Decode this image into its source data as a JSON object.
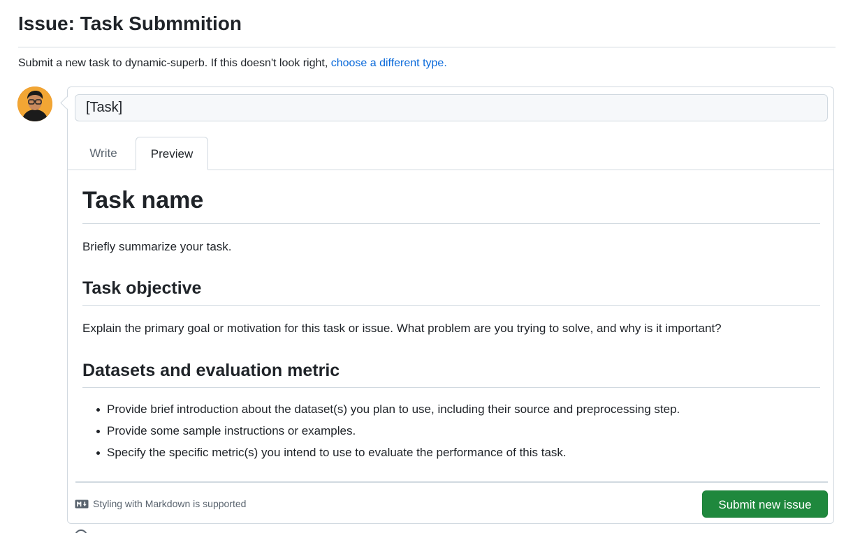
{
  "page": {
    "title": "Issue: Task Submmition",
    "subtitle_text": "Submit a new task to dynamic-superb. If this doesn't look right, ",
    "subtitle_link": "choose a different type."
  },
  "form": {
    "title_value": "[Task]",
    "tabs": [
      {
        "label": "Write",
        "active": false
      },
      {
        "label": "Preview",
        "active": true
      }
    ]
  },
  "preview": {
    "heading": "Task name",
    "summary": "Briefly summarize your task.",
    "objective_heading": "Task objective",
    "objective_text": "Explain the primary goal or motivation for this task or issue. What problem are you trying to solve, and why is it important?",
    "datasets_heading": "Datasets and evaluation metric",
    "bullets": [
      "Provide brief introduction about the dataset(s) you plan to use, including their source and preprocessing step.",
      "Provide some sample instructions or examples.",
      "Specify the specific metric(s) you intend to use to evaluate the performance of this task."
    ]
  },
  "footer": {
    "markdown_note": "Styling with Markdown is supported",
    "markdown_icon": "markdown-icon",
    "submit_label": "Submit new issue"
  },
  "colors": {
    "accent_link": "#0969da",
    "submit_green": "#1f883d",
    "border": "#d1d9e0",
    "muted_text": "#59636e"
  }
}
